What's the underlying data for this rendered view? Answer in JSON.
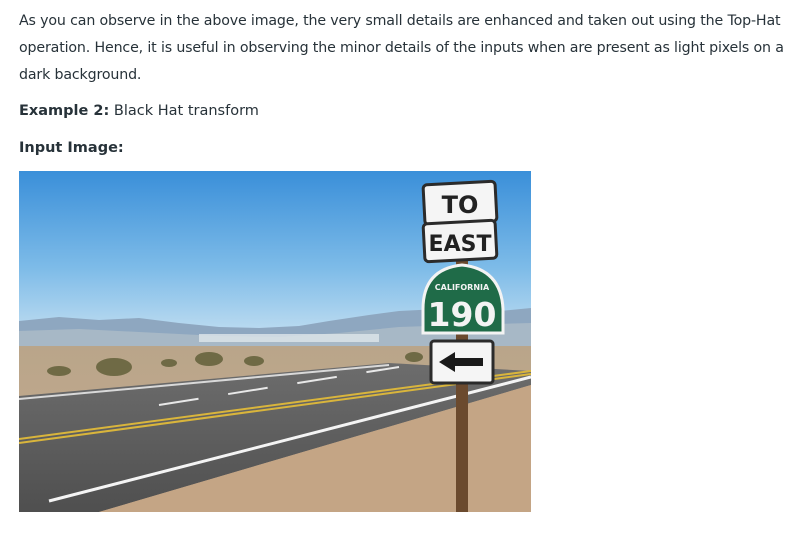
{
  "article": {
    "paragraph": "As you can observe in the above image, the very small details are enhanced and taken out using the Top-Hat operation. Hence, it is useful in observing the minor details of the inputs when are present as light pixels on a dark background.",
    "example_label": "Example 2:",
    "example_title": "Black Hat transform",
    "input_label": "Input Image:"
  },
  "photo": {
    "sign_top_line1": "TO",
    "sign_top_line2": "EAST",
    "shield_state": "CALIFORNIA",
    "shield_number": "190",
    "arrow_sign_icon": "left-arrow-icon"
  }
}
